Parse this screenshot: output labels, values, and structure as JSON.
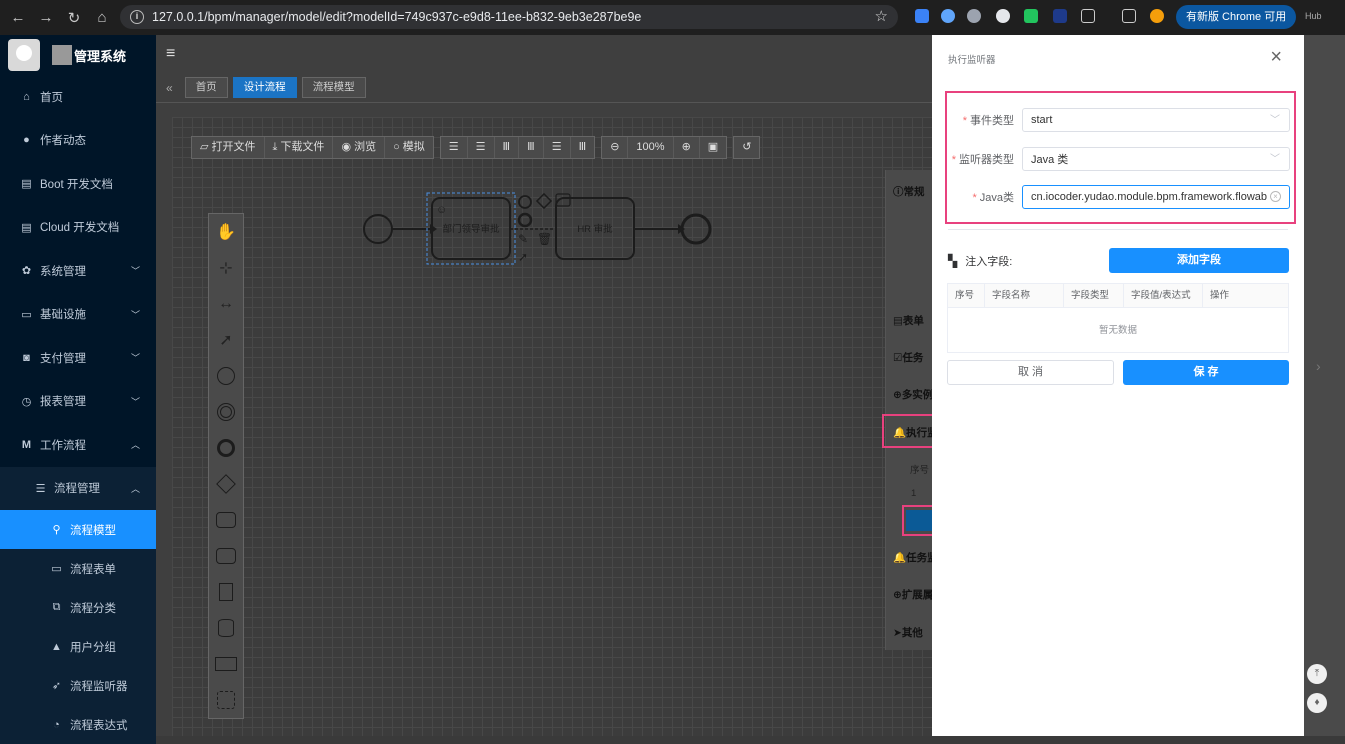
{
  "browser": {
    "url": "127.0.0.1/bpm/manager/model/edit?modelId=749c937c-e9d8-11ee-b832-9eb3e287be9e",
    "update_label": "有新版 Chrome 可用",
    "hub_label": "Hub"
  },
  "app": {
    "name": "管理系统"
  },
  "sidebar": {
    "items": [
      {
        "label": "首页"
      },
      {
        "label": "作者动态"
      },
      {
        "label": "Boot 开发文档"
      },
      {
        "label": "Cloud 开发文档"
      },
      {
        "label": "系统管理"
      },
      {
        "label": "基础设施"
      },
      {
        "label": "支付管理"
      },
      {
        "label": "报表管理"
      },
      {
        "label": "工作流程"
      },
      {
        "label": "流程管理"
      },
      {
        "label": "流程模型"
      },
      {
        "label": "流程表单"
      },
      {
        "label": "流程分类"
      },
      {
        "label": "用户分组"
      },
      {
        "label": "流程监听器"
      },
      {
        "label": "流程表达式"
      }
    ]
  },
  "tabs": [
    "首页",
    "设计流程",
    "流程模型"
  ],
  "toolbar": {
    "open_file": "打开文件",
    "download_file": "下载文件",
    "preview": "浏览",
    "simulate": "模拟",
    "zoom": "100%"
  },
  "diagram": {
    "task1": "部门领导审批",
    "task2": "HR 审批"
  },
  "panel_behind": {
    "general": "常规",
    "form": "表单",
    "task": "任务",
    "multi": "多实例",
    "exec": "执行监",
    "col_index": "序号",
    "row1": "1",
    "task_listener": "任务监",
    "extension": "扩展属",
    "other": "其他"
  },
  "drawer": {
    "title": "执行监听器",
    "event_type_label": "事件类型",
    "event_type_value": "start",
    "listener_type_label": "监听器类型",
    "listener_type_value": "Java 类",
    "java_class_label": "Java类",
    "java_class_value": "cn.iocoder.yudao.module.bpm.framework.flowab",
    "inject_label": "注入字段:",
    "add_field": "添加字段",
    "table_headers": [
      "序号",
      "字段名称",
      "字段类型",
      "字段值/表达式",
      "操作"
    ],
    "empty_text": "暂无数据",
    "cancel": "取 消",
    "save": "保 存"
  },
  "colors": {
    "primary": "#1890ff",
    "sidebar_bg": "#001528",
    "highlight": "#e8417e"
  }
}
